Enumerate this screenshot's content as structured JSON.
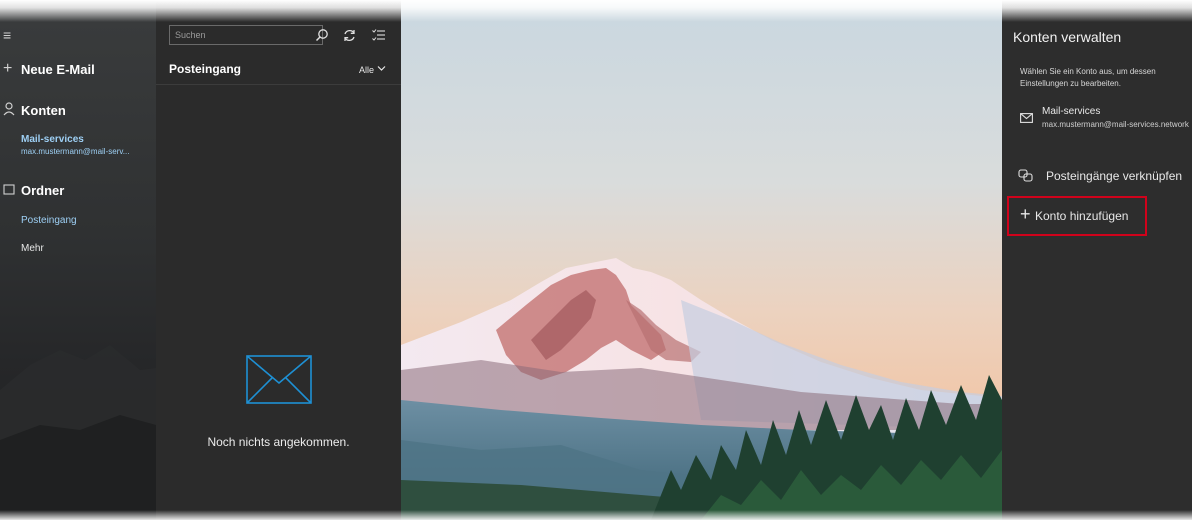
{
  "nav": {
    "new_mail": "Neue E-Mail",
    "accounts_heading": "Konten",
    "account_name": "Mail-services",
    "account_email": "max.mustermann@mail-serv...",
    "folders_heading": "Ordner",
    "inbox": "Posteingang",
    "more": "Mehr"
  },
  "list": {
    "search_placeholder": "Suchen",
    "title": "Posteingang",
    "filter": "Alle",
    "empty_message": "Noch nichts angekommen."
  },
  "panel": {
    "title": "Konten verwalten",
    "description_line1": "Wählen Sie ein Konto aus, um dessen",
    "description_line2": "Einstellungen zu bearbeiten.",
    "account_name": "Mail-services",
    "account_email": "max.mustermann@mail-services.network",
    "link_inboxes": "Posteingänge verknüpfen",
    "add_account": "Konto hinzufügen"
  },
  "colors": {
    "accent_link": "#9ed0f5",
    "highlight_box": "#d0021b",
    "envelope_icon": "#1e90d4"
  },
  "icons": [
    "hamburger-icon",
    "plus-icon",
    "person-icon",
    "folder-icon",
    "search-icon",
    "sync-icon",
    "filter-icon",
    "chevron-down-icon",
    "envelope-icon",
    "mail-icon",
    "link-icon"
  ]
}
